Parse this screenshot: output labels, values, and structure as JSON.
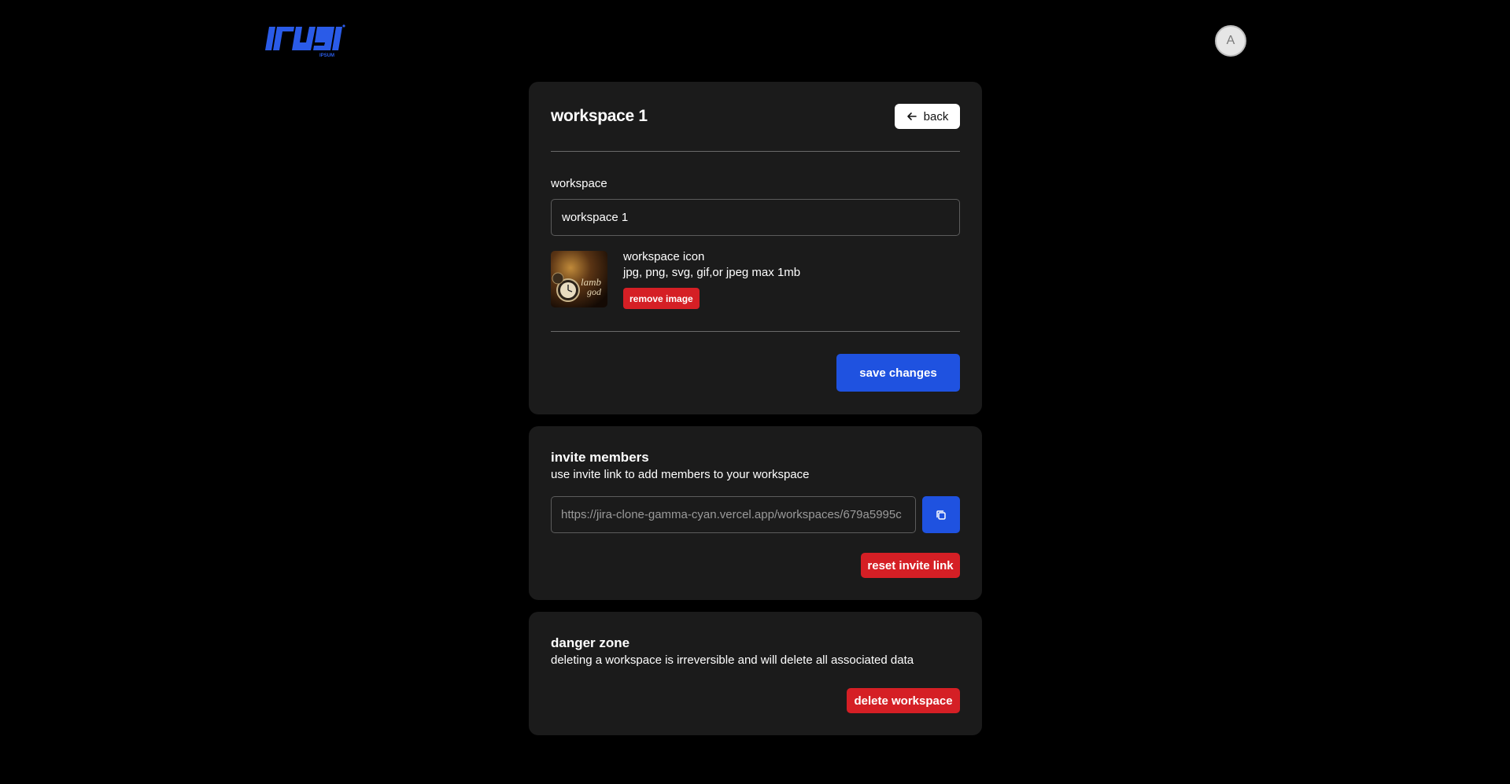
{
  "header": {
    "logo_icon": "logo-ipsum-icon",
    "logo_subtext": "IPSUM",
    "avatar_initial": "A"
  },
  "settings": {
    "title": "workspace 1",
    "back_label": "back",
    "back_icon": "arrow-left-icon",
    "workspace_label": "workspace",
    "workspace_name_value": "workspace 1",
    "icon_label": "workspace icon",
    "icon_hint": "jpg, png, svg, gif,or jpeg max 1mb",
    "remove_image_label": "remove image",
    "save_label": "save changes"
  },
  "invite": {
    "heading": "invite members",
    "description": "use invite link to add members to your workspace",
    "invite_link": "https://jira-clone-gamma-cyan.vercel.app/workspaces/679a5995c",
    "copy_icon": "copy-icon",
    "reset_label": "reset invite link"
  },
  "danger": {
    "heading": "danger zone",
    "description": "deleting a workspace is irreversible and will delete all associated data",
    "delete_label": "delete workspace"
  },
  "colors": {
    "background": "#000000",
    "card": "#1b1b1b",
    "primary": "#1f52e0",
    "danger": "#d51f25",
    "logo": "#2a5be8"
  }
}
